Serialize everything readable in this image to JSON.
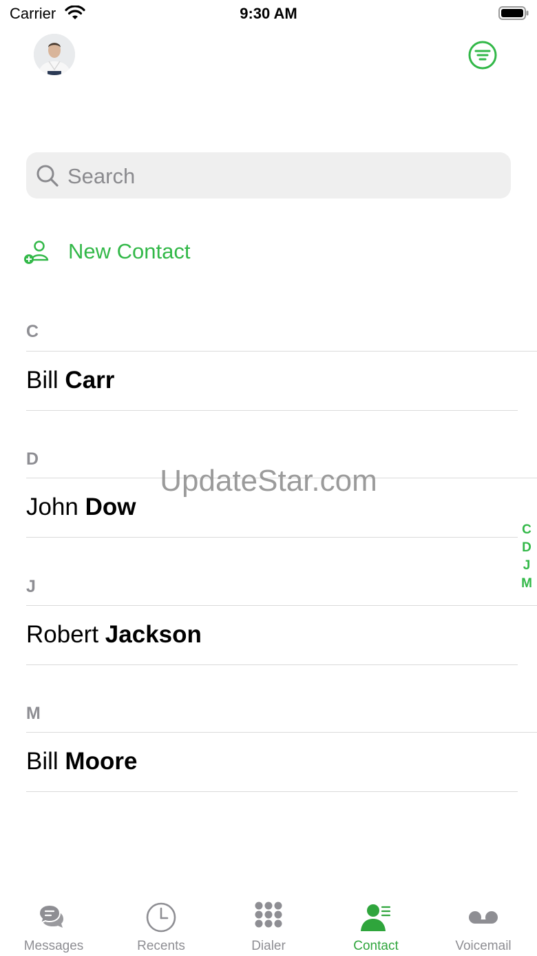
{
  "status_bar": {
    "carrier": "Carrier",
    "time": "9:30 AM",
    "icons": [
      "wifi-icon",
      "battery-icon"
    ]
  },
  "header": {
    "avatar_icon": "user-avatar",
    "filter_icon": "filter-circle-icon"
  },
  "search": {
    "placeholder": "Search",
    "value": "",
    "icon": "search-icon"
  },
  "new_contact": {
    "label": "New Contact",
    "icon": "add-person-icon"
  },
  "sections": [
    {
      "letter": "C",
      "contacts": [
        {
          "first": "Bill",
          "last": "Carr"
        }
      ]
    },
    {
      "letter": "D",
      "contacts": [
        {
          "first": "John",
          "last": "Dow"
        }
      ]
    },
    {
      "letter": "J",
      "contacts": [
        {
          "first": "Robert",
          "last": "Jackson"
        }
      ]
    },
    {
      "letter": "M",
      "contacts": [
        {
          "first": "Bill",
          "last": "Moore"
        }
      ]
    }
  ],
  "index": [
    "C",
    "D",
    "J",
    "M"
  ],
  "watermark": "UpdateStar.com",
  "tabs": [
    {
      "label": "Messages",
      "icon": "messages-icon",
      "active": false
    },
    {
      "label": "Recents",
      "icon": "clock-icon",
      "active": false
    },
    {
      "label": "Dialer",
      "icon": "dialpad-icon",
      "active": false
    },
    {
      "label": "Contact",
      "icon": "contact-icon",
      "active": true
    },
    {
      "label": "Voicemail",
      "icon": "voicemail-icon",
      "active": false
    }
  ],
  "colors": {
    "accent": "#32b848",
    "tab_active": "#2fa53c",
    "tab_inactive": "#8e8e93",
    "section_letter": "#8e8e93",
    "search_bg": "#efefef",
    "divider": "#dadada"
  }
}
